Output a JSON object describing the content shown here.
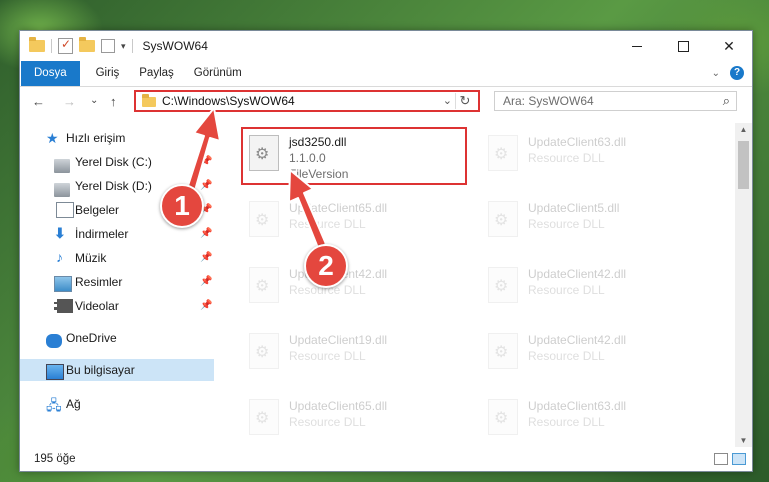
{
  "window": {
    "title": "SysWOW64",
    "controls": {
      "minimize": "minimize-icon",
      "maximize": "maximize-icon",
      "close": "✕"
    }
  },
  "ribbon": {
    "tabs": [
      {
        "label": "Dosya",
        "active": true
      },
      {
        "label": "Giriş"
      },
      {
        "label": "Paylaş"
      },
      {
        "label": "Görünüm"
      }
    ],
    "help": "?"
  },
  "nav": {
    "back": "←",
    "forward": "→",
    "recent": "⌄",
    "up": "↑",
    "address": "C:\\Windows\\SysWOW64",
    "refresh": "↻",
    "search_placeholder": "Ara: SysWOW64"
  },
  "sidebar": {
    "items": [
      {
        "label": "Hızlı erişim",
        "icon": "star-icon"
      },
      {
        "label": "Yerel Disk (C:)",
        "icon": "disk-icon",
        "pinned": true
      },
      {
        "label": "Yerel Disk (D:)",
        "icon": "disk-icon",
        "pinned": true
      },
      {
        "label": "Belgeler",
        "icon": "document-icon",
        "pinned": true
      },
      {
        "label": "İndirmeler",
        "icon": "download-icon",
        "pinned": true
      },
      {
        "label": "Müzik",
        "icon": "music-icon",
        "pinned": true
      },
      {
        "label": "Resimler",
        "icon": "pictures-icon",
        "pinned": true
      },
      {
        "label": "Videolar",
        "icon": "video-icon",
        "pinned": true
      },
      {
        "label": "OneDrive",
        "icon": "cloud-icon"
      },
      {
        "label": "Bu bilgisayar",
        "icon": "computer-icon",
        "selected": true
      },
      {
        "label": "Ağ",
        "icon": "network-icon"
      }
    ]
  },
  "files": [
    {
      "name": "jsd3250.dll",
      "line1": "1.1.0.0",
      "line2": "FileVersion",
      "highlighted": true
    },
    {
      "name": "UpdateClient63.dll",
      "line1": "Resource DLL"
    },
    {
      "name": "UpdateClient65.dll",
      "line1": "Resource DLL"
    },
    {
      "name": "UpdateClient5.dll",
      "line1": "Resource DLL"
    },
    {
      "name": "UpdateClient42.dll",
      "line1": "Resource DLL"
    },
    {
      "name": "UpdateClient42.dll",
      "line1": "Resource DLL"
    },
    {
      "name": "UpdateClient19.dll",
      "line1": "Resource DLL"
    },
    {
      "name": "UpdateClient42.dll",
      "line1": "Resource DLL"
    },
    {
      "name": "UpdateClient65.dll",
      "line1": "Resource DLL"
    },
    {
      "name": "UpdateClient63.dll",
      "line1": "Resource DLL"
    }
  ],
  "status": {
    "count": "195 öğe"
  },
  "callouts": {
    "one": "1",
    "two": "2"
  },
  "colors": {
    "accent": "#1979ca",
    "highlight": "#dd3333",
    "callout": "#e4473e"
  }
}
